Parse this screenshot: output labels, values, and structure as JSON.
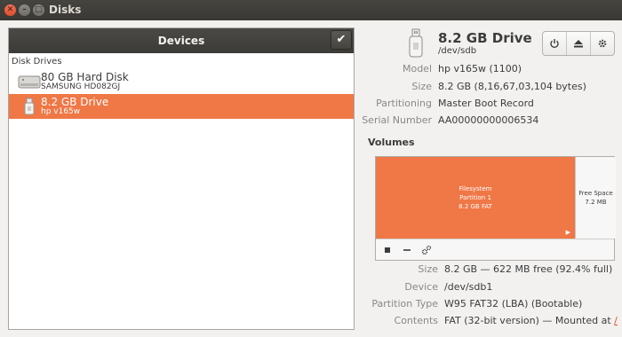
{
  "window": {
    "title": "Disks"
  },
  "devices_panel": {
    "header": "Devices",
    "section": "Disk Drives",
    "items": [
      {
        "name": "80 GB Hard Disk",
        "sub": "SAMSUNG HD082GJ",
        "selected": false,
        "icon": "hard-disk-icon"
      },
      {
        "name": "8.2 GB Drive",
        "sub": "hp v165w",
        "selected": true,
        "icon": "usb-drive-icon"
      }
    ]
  },
  "drive": {
    "title": "8.2 GB Drive",
    "path": "/dev/sdb",
    "properties": [
      {
        "label": "Model",
        "value": "hp v165w (1100)"
      },
      {
        "label": "Size",
        "value": "8.2 GB (8,16,67,03,104 bytes)"
      },
      {
        "label": "Partitioning",
        "value": "Master Boot Record"
      },
      {
        "label": "Serial Number",
        "value": "AA00000000006534"
      }
    ],
    "buttons": [
      "power-icon",
      "eject-icon",
      "gear-icon"
    ]
  },
  "volumes": {
    "title": "Volumes",
    "partition": {
      "line1": "Filesystem",
      "line2": "Partition 1",
      "line3": "8.2 GB FAT",
      "fill_percent": 83
    },
    "free": {
      "line1": "Free Space",
      "line2": "7.2 MB"
    },
    "properties": [
      {
        "label": "Size",
        "value": "8.2 GB — 622 MB free (92.4% full)"
      },
      {
        "label": "Device",
        "value": "/dev/sdb1"
      },
      {
        "label": "Partition Type",
        "value": "W95 FAT32 (LBA) (Bootable)"
      },
      {
        "label": "Contents",
        "value": "FAT (32-bit version) — Mounted at",
        "link": "/..."
      }
    ]
  },
  "colors": {
    "accent": "#f07746",
    "titlebar": "#3c3b37",
    "label_gray": "#8a8884"
  }
}
